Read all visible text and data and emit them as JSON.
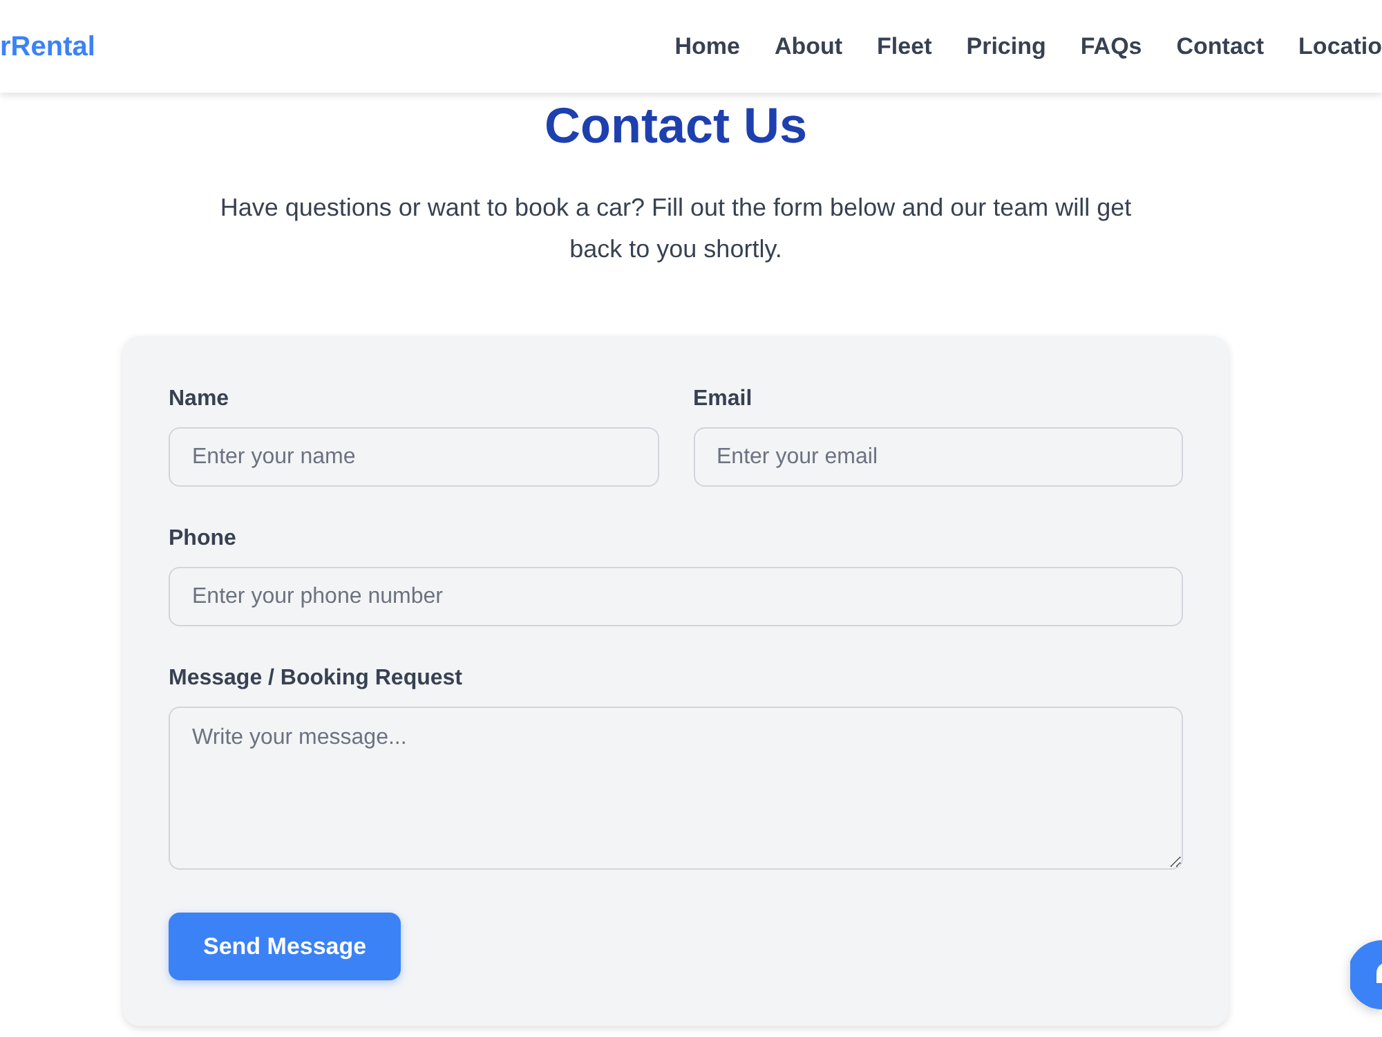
{
  "navbar": {
    "brand": "rRental",
    "links": [
      "Home",
      "About",
      "Fleet",
      "Pricing",
      "FAQs",
      "Contact",
      "Locatio"
    ]
  },
  "header": {
    "title": "Contact Us",
    "subtitle": "Have questions or want to book a car? Fill out the form below and our team will get back to you shortly."
  },
  "form": {
    "rows": [
      [
        {
          "kind": "input",
          "label": "Name",
          "placeholder": "Enter your name"
        },
        {
          "kind": "input",
          "label": "Email",
          "placeholder": "Enter your email"
        }
      ],
      [
        {
          "kind": "input",
          "label": "Phone",
          "placeholder": "Enter your phone number"
        }
      ],
      [
        {
          "kind": "textarea",
          "label": "Message / Booking Request",
          "placeholder": "Write your message..."
        }
      ]
    ],
    "submit": "Send Message"
  }
}
